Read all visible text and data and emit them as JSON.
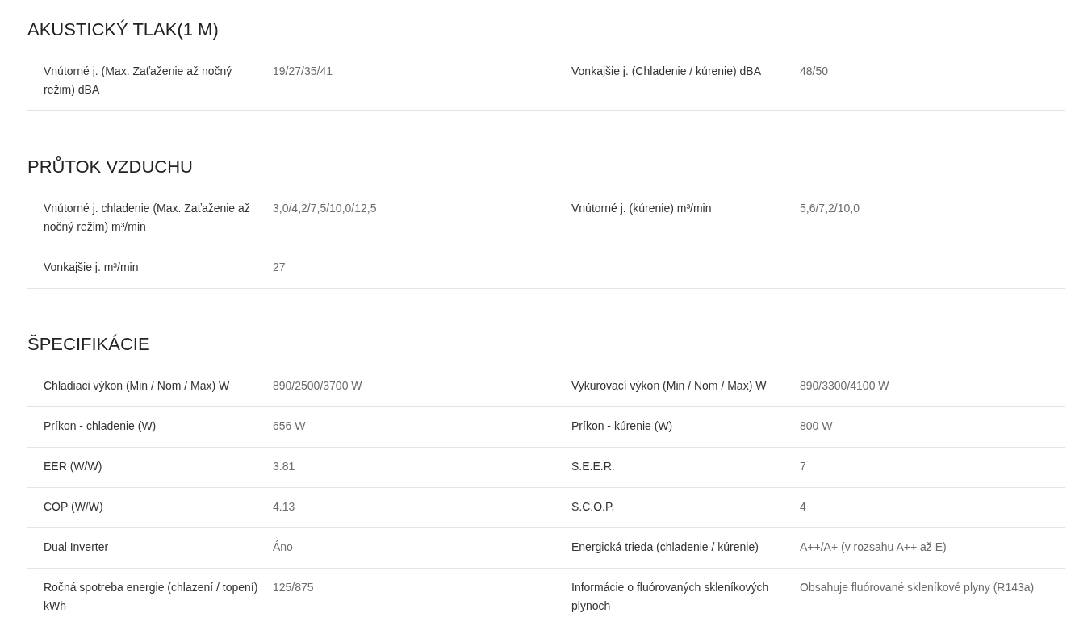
{
  "sections": [
    {
      "title": "AKUSTICKÝ TLAK(1 M)",
      "rows": [
        {
          "pairs": [
            {
              "label": "Vnútorné j. (Max. Zaťaženie až nočný režim) dBA",
              "value": "19/27/35/41"
            },
            {
              "label": "Vonkajšie j. (Chladenie / kúrenie) dBA",
              "value": "48/50"
            }
          ]
        }
      ]
    },
    {
      "title": "PRŮTOK VZDUCHU",
      "rows": [
        {
          "pairs": [
            {
              "label": "Vnútorné j. chladenie (Max. Zaťaženie až nočný režim) m³/min",
              "value": "3,0/4,2/7,5/10,0/12,5"
            },
            {
              "label": "Vnútorné j. (kúrenie) m³/min",
              "value": "5,6/7,2/10,0"
            }
          ]
        },
        {
          "pairs": [
            {
              "label": "Vonkajšie j. m³/min",
              "value": "27"
            }
          ]
        }
      ]
    },
    {
      "title": "ŠPECIFIKÁCIE",
      "rows": [
        {
          "pairs": [
            {
              "label": "Chladiaci výkon (Min / Nom / Max) W",
              "value": "890/2500/3700 W"
            },
            {
              "label": "Vykurovací výkon (Min / Nom / Max) W",
              "value": "890/3300/4100 W"
            }
          ]
        },
        {
          "pairs": [
            {
              "label": "Príkon - chladenie (W)",
              "value": "656 W"
            },
            {
              "label": "Príkon - kúrenie (W)",
              "value": "800 W"
            }
          ]
        },
        {
          "pairs": [
            {
              "label": "EER (W/W)",
              "value": "3.81"
            },
            {
              "label": "S.E.E.R.",
              "value": "7"
            }
          ]
        },
        {
          "pairs": [
            {
              "label": "COP (W/W)",
              "value": "4.13"
            },
            {
              "label": "S.C.O.P.",
              "value": "4"
            }
          ]
        },
        {
          "pairs": [
            {
              "label": "Dual Inverter",
              "value": "Áno"
            },
            {
              "label": "Energická trieda (chladenie / kúrenie)",
              "value": "A++/A+ (v rozsahu A++ až E)"
            }
          ]
        },
        {
          "pairs": [
            {
              "label": "Ročná spotreba energie (chlazení / topení) kWh",
              "value": "125/875"
            },
            {
              "label": "Informácie o fluórovaných skleníkových plynoch",
              "value": "Obsahuje fluórované skleníkové plyny (R143a)"
            }
          ]
        }
      ]
    }
  ]
}
